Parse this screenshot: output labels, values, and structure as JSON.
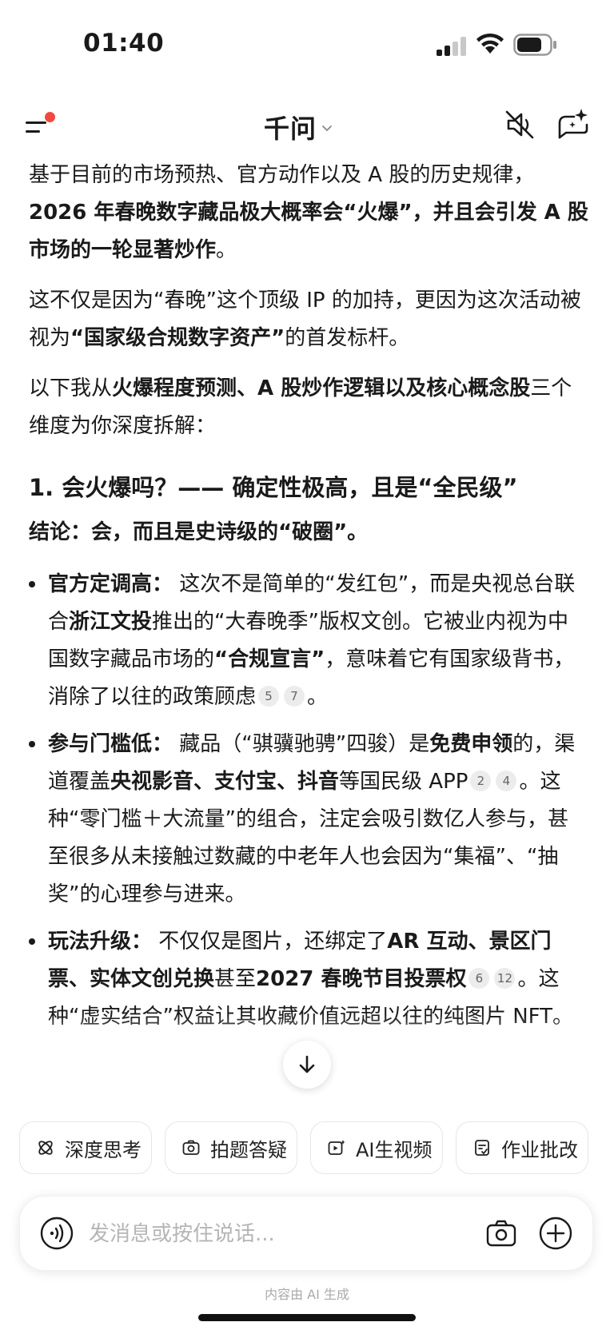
{
  "status_bar": {
    "time": "01:40"
  },
  "header": {
    "title": "千问"
  },
  "content": {
    "para1": {
      "t1": "基于目前的市场预热、官方动作以及 A 股的历史规律，",
      "b1": "2026 年春晚数字藏品极大概率会“火爆”，并且会引发 A 股市场的一轮显著炒作",
      "t2": "。"
    },
    "para2": {
      "t1": "这不仅是因为“春晚”这个顶级 IP 的加持，更因为这次活动被视为",
      "b1": "“国家级合规数字资产”",
      "t2": "的首发标杆。"
    },
    "para3": {
      "t1": "以下我从",
      "b1": "火爆程度预测、A 股炒作逻辑以及核心概念股",
      "t2": "三个维度为你深度拆解："
    },
    "section1_heading": "1. 会火爆吗？—— 确定性极高，且是“全民级”",
    "conclusion": "结论：会，而且是史诗级的“破圈”。",
    "bullets": [
      {
        "label": "官方定调高：",
        "t1": "这次不是简单的“发红包”，而是央视总台联合",
        "b1": "浙江文投",
        "t2": "推出的“大春晚季”版权文创。它被业内视为中国数字藏品市场的",
        "b2": "“合规宣言”",
        "t3": "，意味着它有国家级背书，消除了以往的政策顾虑",
        "refs": [
          "5",
          "7"
        ],
        "t4": "。"
      },
      {
        "label": "参与门槛低：",
        "t1": "藏品（“骐骥驰骋”四骏）是",
        "b1": "免费申领",
        "t2": "的，渠道覆盖",
        "b2": "央视影音、支付宝、抖音",
        "t3": "等国民级 APP",
        "refs": [
          "2",
          "4"
        ],
        "t4": "。这种“零门槛＋大流量”的组合，注定会吸引数亿人参与，甚至很多从未接触过数藏的中老年人也会因为“集福”、“抽奖”的心理参与进来。"
      },
      {
        "label": "玩法升级：",
        "t1": "不仅仅是图片，还绑定了",
        "b1": "AR 互动、景区门票、实体文创兑换",
        "t2": "甚至",
        "b2": "2027 春晚节目投票权",
        "refs": [
          "6",
          "12"
        ],
        "t3": "。这种“虚实结合”权益让其收藏价值远超以往的纯图片 NFT。"
      }
    ]
  },
  "quick_actions": [
    {
      "label": "深度思考",
      "icon": "deep-think-icon"
    },
    {
      "label": "拍题答疑",
      "icon": "photo-question-icon"
    },
    {
      "label": "AI生视频",
      "icon": "ai-video-icon"
    },
    {
      "label": "作业批改",
      "icon": "homework-icon"
    }
  ],
  "input": {
    "placeholder": "发消息或按住说话..."
  },
  "footer": {
    "disclaimer": "内容由 AI 生成"
  }
}
